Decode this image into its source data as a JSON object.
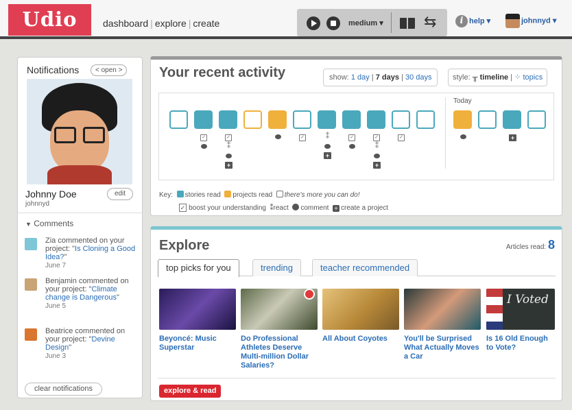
{
  "header": {
    "logo": "Udio",
    "nav": [
      "dashboard",
      "explore",
      "create"
    ],
    "speed": "medium ▾",
    "help": "help ▾",
    "user": "johnnyd ▾"
  },
  "notifications": {
    "title": "Notifications",
    "open_label": "< open >",
    "name": "Johnny Doe",
    "username": "johnnyd",
    "edit_label": "edit",
    "comments_heading": "Comments",
    "items": [
      {
        "prefix": "Zia commented on your project: \"",
        "link": "Is Cloning a Good Idea?",
        "suffix": "\"",
        "date": "June 7"
      },
      {
        "prefix": "Benjamin commented on your project: \"",
        "link": "Climate change is Dangerous",
        "suffix": "\"",
        "date": "June 5"
      },
      {
        "prefix": "Beatrice commented on your project: \"",
        "link": "Devine Design",
        "suffix": "\"",
        "date": "June 3"
      }
    ],
    "clear_label": "clear notifications"
  },
  "activity": {
    "title": "Your recent activity",
    "show_label": "show:",
    "show_options": [
      "1 day",
      "7 days",
      "30 days"
    ],
    "style_label": "style:",
    "style_options": [
      "timeline",
      "topics"
    ],
    "today_label": "Today",
    "key": {
      "label": "Key:",
      "stories": "stories read",
      "projects": "projects read",
      "more": "there's more you can do!",
      "boost": "boost your understanding",
      "react": "react",
      "comment": "comment",
      "create": "create a project"
    },
    "colors": {
      "stories": "#4aa8bc",
      "projects": "#f0b03c"
    }
  },
  "explore": {
    "title": "Explore",
    "articles_read_label": "Articles read:",
    "articles_read": "8",
    "tabs": [
      "top picks for you",
      "trending",
      "teacher recommended"
    ],
    "articles": [
      "Beyoncé: Music Superstar",
      "Do Professional Athletes Deserve Multi-million Dollar Salaries?",
      "All About Coyotes",
      "You'll be Surprised What Actually Moves a Car",
      "Is 16 Old Enough to Vote?"
    ],
    "thumb5_text": "I Voted",
    "button": "explore & read"
  }
}
